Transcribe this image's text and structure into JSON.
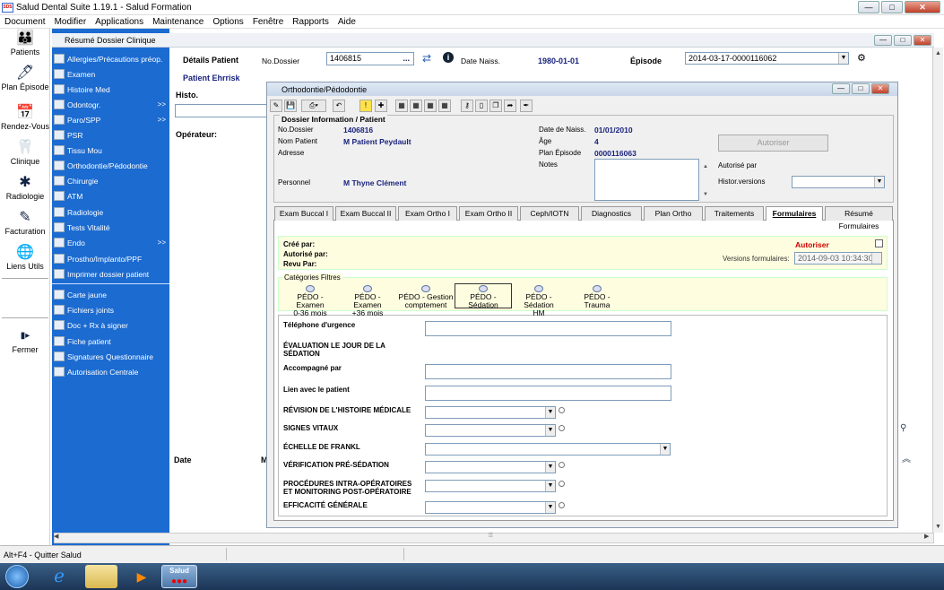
{
  "app": {
    "title": "Salud Dental Suite 1.19.1 - Salud Formation",
    "logo": "SDS",
    "min": "—",
    "max": "□",
    "close": "✕"
  },
  "menu": [
    "Document",
    "Modifier",
    "Applications",
    "Maintenance",
    "Options",
    "Fenêtre",
    "Rapports",
    "Aide"
  ],
  "left_nav": [
    {
      "label": "Patients",
      "icon": "👪"
    },
    {
      "label": "Plan Épisode",
      "icon": "🖊"
    },
    {
      "label": "Rendez-Vous",
      "icon": "📅"
    },
    {
      "label": "Clinique",
      "icon": "🦷"
    },
    {
      "label": "Radiologie",
      "icon": "✱"
    },
    {
      "label": "Facturation",
      "icon": "✎"
    },
    {
      "label": "Liens Utils",
      "icon": "🌐"
    },
    {
      "label": "Fermer",
      "icon": "▮▸"
    }
  ],
  "blue_menu": [
    {
      "label": "Allergies/Précautions préop.",
      "arrow": ""
    },
    {
      "label": "Examen",
      "arrow": ""
    },
    {
      "label": "Histoire Med",
      "arrow": ""
    },
    {
      "label": "Odontogr.",
      "arrow": ">>"
    },
    {
      "label": "Paro/SPP",
      "arrow": ">>"
    },
    {
      "label": "PSR",
      "arrow": ""
    },
    {
      "label": "Tissu Mou",
      "arrow": ""
    },
    {
      "label": "Orthodontie/Pédodontie",
      "arrow": ""
    },
    {
      "label": "Chirurgie",
      "arrow": ""
    },
    {
      "label": "ATM",
      "arrow": ""
    },
    {
      "label": "Radiologie",
      "arrow": ""
    },
    {
      "label": "Tests Vitalité",
      "arrow": ""
    },
    {
      "label": "Endo",
      "arrow": ">>"
    },
    {
      "label": "Prostho/Implanto/PPF",
      "arrow": ""
    },
    {
      "label": "Imprimer dossier patient",
      "arrow": ""
    },
    {
      "label": "Carte jaune",
      "arrow": ""
    },
    {
      "label": "Fichiers joints",
      "arrow": ""
    },
    {
      "label": "Doc + Rx à signer",
      "arrow": ""
    },
    {
      "label": "Fiche patient",
      "arrow": ""
    },
    {
      "label": "Signatures Questionnaire",
      "arrow": ""
    },
    {
      "label": "Autorisation Centrale",
      "arrow": ""
    }
  ],
  "main_window": {
    "title": "Résumé Dossier Clinique",
    "details_label": "Détails Patient",
    "nodossier_label": "No.Dossier",
    "nodossier_value": "1406815",
    "ellipsis": "...",
    "naiss_label": "Date Naiss.",
    "naiss_value": "1980-01-01",
    "episode_label": "Épisode",
    "episode_value": "2014-03-17-0000116062",
    "patient_name": "Patient Ehrrisk",
    "histo_label": "Histo.",
    "operateur_label": "Opérateur:",
    "date_label": "Date",
    "m_label": "M"
  },
  "dialog": {
    "title": "Orthodontie/Pédodontie",
    "section_title": "Dossier Information / Patient",
    "nodossier_label": "No.Dossier",
    "nodossier_value": "1406816",
    "nom_label": "Nom Patient",
    "nom_value": "M Patient Peydault",
    "adresse_label": "Adresse",
    "personnel_label": "Personnel",
    "personnel_value": "M Thyne Clément",
    "naiss_label": "Date de Naiss.",
    "naiss_value": "01/01/2010",
    "age_label": "Âge",
    "age_value": "4",
    "plan_label": "Plan Épisode",
    "plan_value": "0000116063",
    "notes_label": "Notes",
    "autoriser_button": "Autoriser",
    "autorise_par_label": "Autorisé par",
    "histor_label": "Histor.versions"
  },
  "tabs": [
    "Exam Buccal I",
    "Exam Buccal II",
    "Exam Ortho I",
    "Exam Ortho II",
    "Ceph/IOTN",
    "Diagnostics",
    "Plan Ortho",
    "Traitements",
    "Formulaires",
    "Résumé Formulaires"
  ],
  "form_header": {
    "cree_par": "Créé par:",
    "autorise_par": "Autorisé par:",
    "revu_par": "Revu Par:",
    "autoriser": "Autoriser",
    "versions_label": "Versions formulaires:",
    "versions_value": "2014-09-03 10:34:30"
  },
  "categories": {
    "title": "Catégories Filtres",
    "items": [
      {
        "l1": "PÉDO - Examen",
        "l2": "0-36 mois"
      },
      {
        "l1": "PÉDO - Examen",
        "l2": "+36 mois"
      },
      {
        "l1": "PÉDO - Gestion",
        "l2": "comptement"
      },
      {
        "l1": "PÉDO - Sédation",
        "l2": ""
      },
      {
        "l1": "PÉDO - Sédation",
        "l2": "HM"
      },
      {
        "l1": "PÉDO - Trauma",
        "l2": ""
      }
    ]
  },
  "form_fields": [
    {
      "label": "Téléphone d'urgence",
      "type": "text"
    },
    {
      "label": "ÉVALUATION LE JOUR DE LA SÉDATION",
      "type": "label"
    },
    {
      "label": "Accompagné par",
      "type": "text"
    },
    {
      "label": "Lien avec le patient",
      "type": "text"
    },
    {
      "label": "RÉVISION DE L'HISTOIRE MÉDICALE",
      "type": "select"
    },
    {
      "label": "SIGNES VITAUX",
      "type": "select"
    },
    {
      "label": "ÉCHELLE DE FRANKL",
      "type": "select-wide"
    },
    {
      "label": "VÉRIFICATION PRÉ-SÉDATION",
      "type": "select"
    },
    {
      "label": "PROCÉDURES INTRA-OPÉRATOIRES ET MONITORING POST-OPÉRATOIRE",
      "type": "select"
    },
    {
      "label": "EFFICACITÉ GÉNÉRALE",
      "type": "select"
    }
  ],
  "status": {
    "text": "Alt+F4 - Quitter Salud"
  },
  "taskbar": {
    "salud_label": "Salud"
  },
  "colors": {
    "menu_blue": "#1b6bd1",
    "navy": "#1a237e",
    "red": "#cc0000",
    "form_yellow": "#fffde0"
  }
}
